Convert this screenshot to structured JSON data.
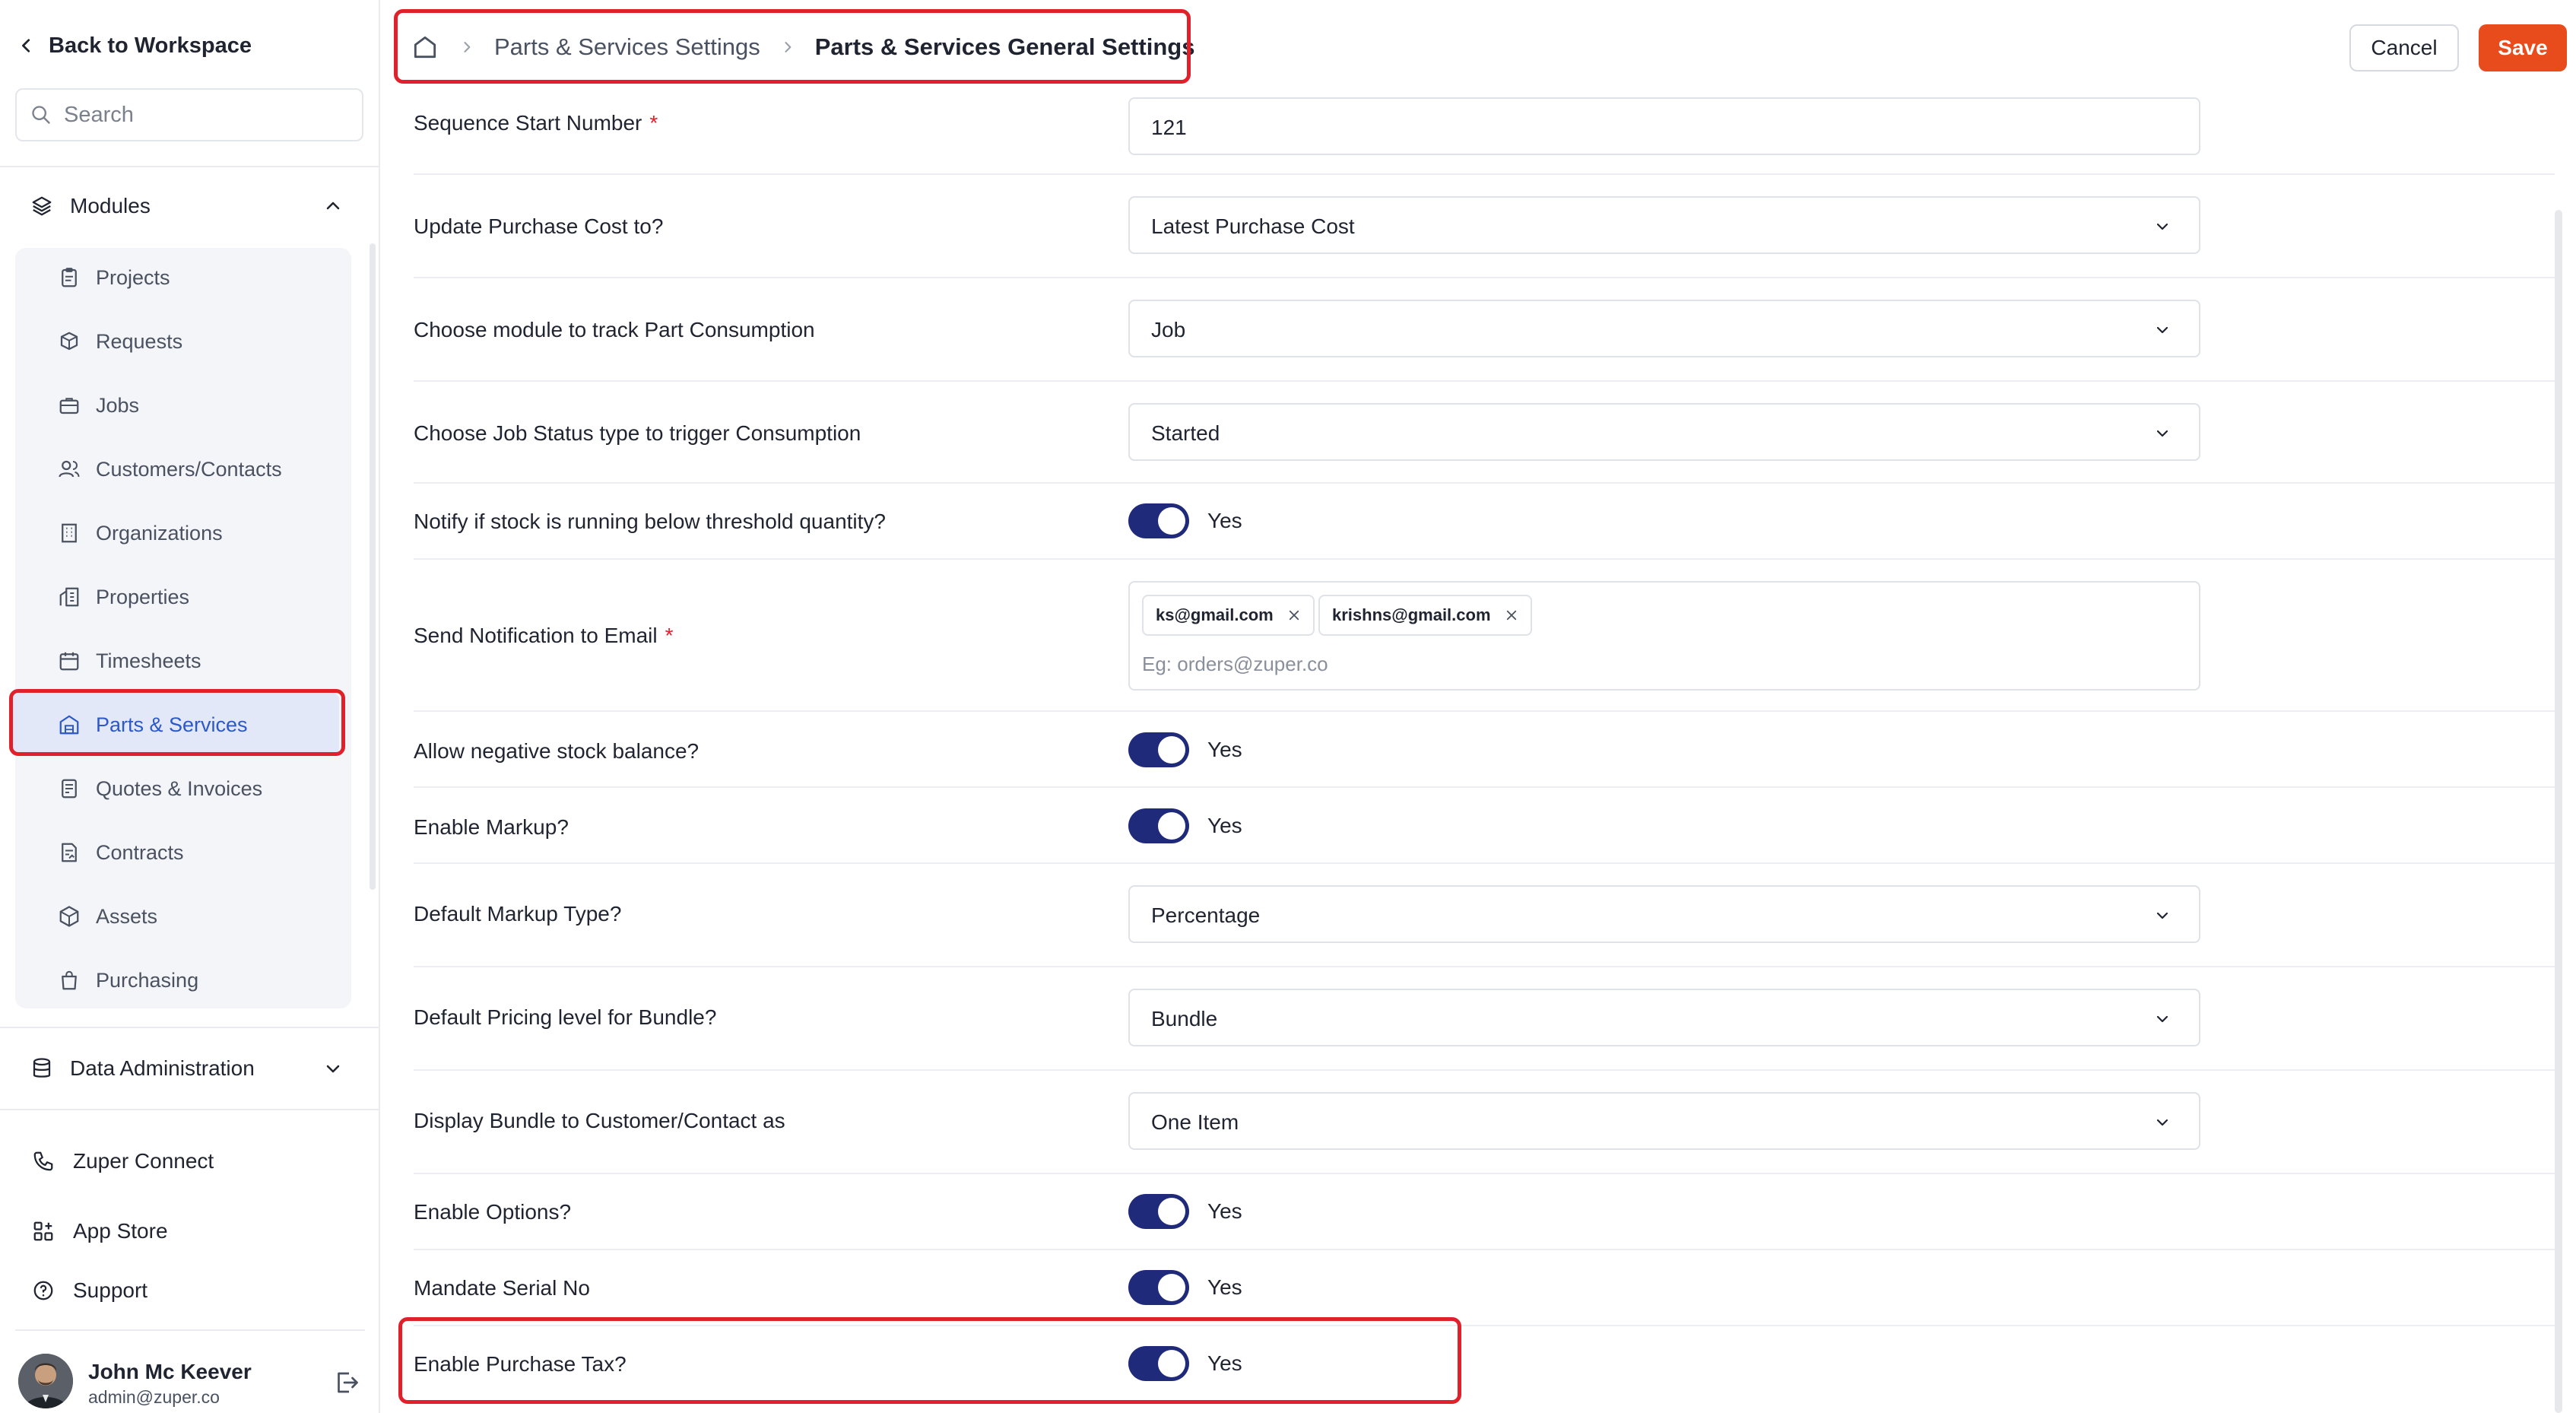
{
  "sidebar": {
    "back_label": "Back to Workspace",
    "search_placeholder": "Search",
    "modules_label": "Modules",
    "modules": [
      {
        "label": "Projects",
        "icon": "clipboard-icon"
      },
      {
        "label": "Requests",
        "icon": "box-request-icon"
      },
      {
        "label": "Jobs",
        "icon": "briefcase-icon"
      },
      {
        "label": "Customers/Contacts",
        "icon": "users-icon"
      },
      {
        "label": "Organizations",
        "icon": "building-icon"
      },
      {
        "label": "Properties",
        "icon": "property-icon"
      },
      {
        "label": "Timesheets",
        "icon": "calendar-icon"
      },
      {
        "label": "Parts & Services",
        "icon": "warehouse-icon"
      },
      {
        "label": "Quotes & Invoices",
        "icon": "invoice-icon"
      },
      {
        "label": "Contracts",
        "icon": "contract-icon"
      },
      {
        "label": "Assets",
        "icon": "cube-icon"
      },
      {
        "label": "Purchasing",
        "icon": "shopping-bag-icon"
      }
    ],
    "active_module": "Parts & Services",
    "data_admin_label": "Data Administration",
    "zuper_connect_label": "Zuper Connect",
    "app_store_label": "App Store",
    "support_label": "Support",
    "user": {
      "name": "John Mc Keever",
      "email": "admin@zuper.co"
    }
  },
  "header": {
    "breadcrumb": [
      "Parts & Services Settings",
      "Parts & Services General Settings"
    ],
    "cancel_label": "Cancel",
    "save_label": "Save"
  },
  "colors": {
    "accent": "#1f2a7a",
    "save": "#e84c1c",
    "active_link": "#2c58c8",
    "highlight": "#e0202a"
  },
  "form": {
    "sequence_start": {
      "label": "Sequence Start Number",
      "required": "*",
      "value": "121"
    },
    "update_purchase_cost": {
      "label": "Update Purchase Cost to?",
      "value": "Latest Purchase Cost"
    },
    "track_module": {
      "label": "Choose module to track Part Consumption",
      "value": "Job"
    },
    "job_status": {
      "label": "Choose Job Status type to trigger Consumption",
      "value": "Started"
    },
    "notify_threshold": {
      "label": "Notify if stock is running below threshold quantity?",
      "state": "Yes",
      "on": true
    },
    "notification_email": {
      "label": "Send Notification to Email",
      "required": "*",
      "chips": [
        "ks@gmail.com",
        "krishns@gmail.com"
      ],
      "placeholder": "Eg: orders@zuper.co"
    },
    "negative_stock": {
      "label": "Allow negative stock balance?",
      "state": "Yes",
      "on": true
    },
    "enable_markup": {
      "label": "Enable Markup?",
      "state": "Yes",
      "on": true
    },
    "markup_type": {
      "label": "Default Markup Type?",
      "value": "Percentage"
    },
    "bundle_pricing": {
      "label": "Default Pricing level for Bundle?",
      "value": "Bundle"
    },
    "display_bundle": {
      "label": "Display Bundle to Customer/Contact as",
      "value": "One Item"
    },
    "enable_options": {
      "label": "Enable Options?",
      "state": "Yes",
      "on": true
    },
    "mandate_serial": {
      "label": "Mandate Serial No",
      "state": "Yes",
      "on": true
    },
    "purchase_tax": {
      "label": "Enable Purchase Tax?",
      "state": "Yes",
      "on": true
    }
  }
}
